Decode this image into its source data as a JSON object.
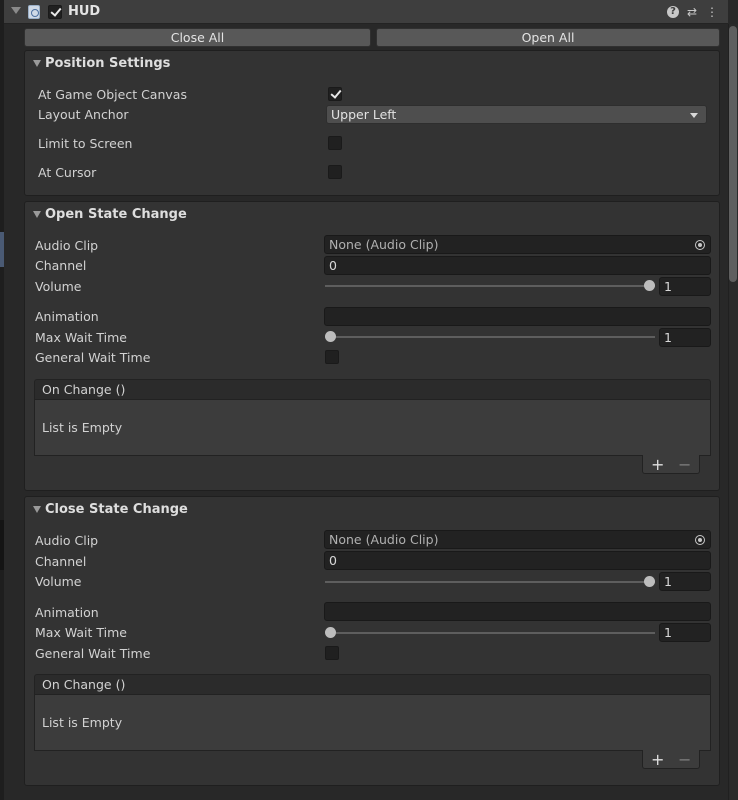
{
  "header": {
    "title": "HUD",
    "enabled": true
  },
  "toolbar": {
    "close_all_label": "Close All",
    "open_all_label": "Open All"
  },
  "position_settings": {
    "title": "Position Settings",
    "at_game_object_canvas_label": "At Game Object Canvas",
    "at_game_object_canvas": true,
    "layout_anchor_label": "Layout Anchor",
    "layout_anchor_value": "Upper Left",
    "limit_to_screen_label": "Limit to Screen",
    "limit_to_screen": false,
    "at_cursor_label": "At Cursor",
    "at_cursor": false
  },
  "open_state": {
    "title": "Open State Change",
    "audio_clip_label": "Audio Clip",
    "audio_clip_value": "None (Audio Clip)",
    "channel_label": "Channel",
    "channel_value": "0",
    "volume_label": "Volume",
    "volume_value": "1",
    "volume_fraction": 1.0,
    "animation_label": "Animation",
    "animation_value": "",
    "max_wait_time_label": "Max Wait Time",
    "max_wait_time_value": "1",
    "max_wait_fraction": 0.0,
    "general_wait_time_label": "General Wait Time",
    "general_wait_time": false,
    "event_label": "On Change ()",
    "event_empty_label": "List is Empty",
    "add_icon": "+",
    "remove_icon": "−"
  },
  "close_state": {
    "title": "Close State Change",
    "audio_clip_label": "Audio Clip",
    "audio_clip_value": "None (Audio Clip)",
    "channel_label": "Channel",
    "channel_value": "0",
    "volume_label": "Volume",
    "volume_value": "1",
    "volume_fraction": 1.0,
    "animation_label": "Animation",
    "animation_value": "",
    "max_wait_time_label": "Max Wait Time",
    "max_wait_time_value": "1",
    "max_wait_fraction": 0.0,
    "general_wait_time_label": "General Wait Time",
    "general_wait_time": false,
    "event_label": "On Change ()",
    "event_empty_label": "List is Empty",
    "add_icon": "+",
    "remove_icon": "−"
  },
  "icons": {
    "help": "?",
    "presets": "⇄",
    "menu": "⋮"
  }
}
